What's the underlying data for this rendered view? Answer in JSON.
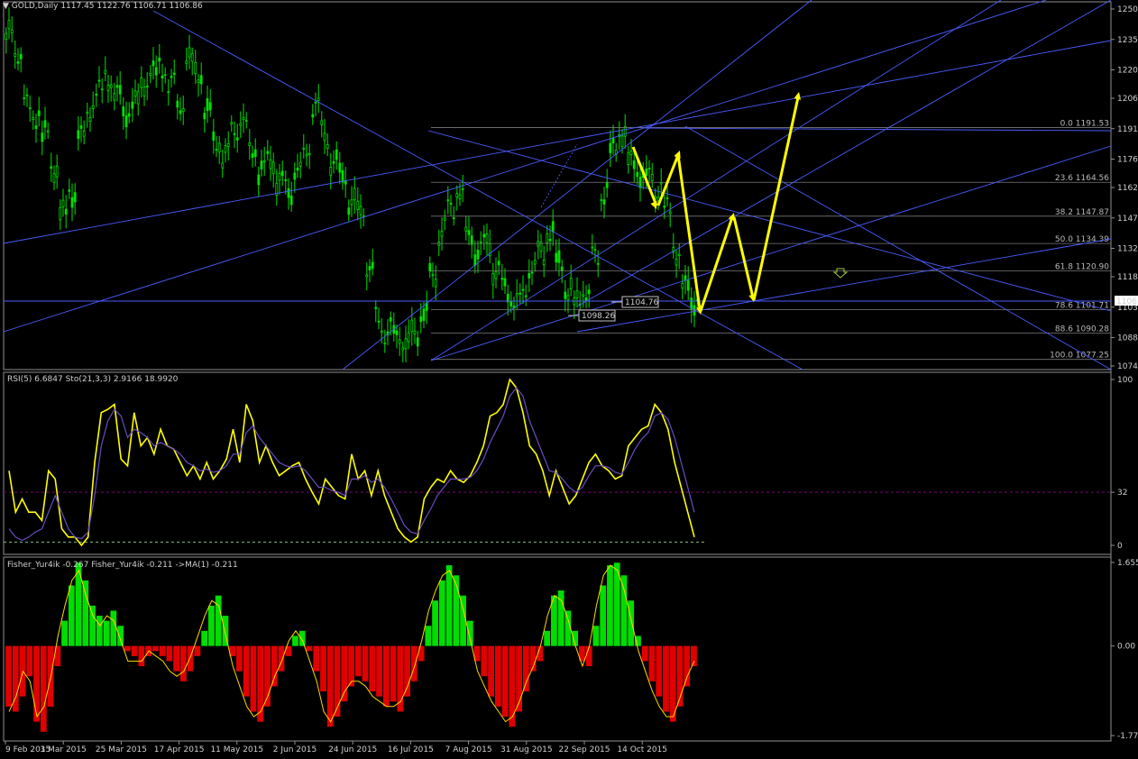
{
  "header": {
    "menu_arrow": "▼",
    "symbol": "GOLD,Daily",
    "ohlc": "1117.45 1122.76 1106.71 1106.86"
  },
  "rsi_panel": {
    "label": "RSI(5) 6.6847  Sto(21,3,3) 2.9166 18.9920"
  },
  "fisher_panel": {
    "label": "Fisher_Yur4ik -0.267  Fisher_Yur4ik -0.211  ->MA(1) -0.211"
  },
  "colors": {
    "background": "#000000",
    "candle": "#00e000",
    "trendline": "#4a5cff",
    "arrow": "#ffff00",
    "rsi": "#ffff00",
    "stoch": "#6a4cc0",
    "hist_pos": "#00dd00",
    "hist_neg": "#e00000",
    "grid_text": "#cfcfcf"
  },
  "chart_data": [
    {
      "type": "candlestick",
      "ylim": [
        1074,
        1250
      ],
      "yticks": [
        "1250",
        "1235",
        "1220",
        "1206",
        "1191",
        "1176",
        "1162",
        "1147",
        "1132",
        "1118",
        "1103",
        "1088",
        "1074"
      ],
      "current_price": "1106",
      "fibonacci": [
        {
          "label": "0.0  1191.53"
        },
        {
          "label": "23.6  1164.56"
        },
        {
          "label": "38.2  1147.87"
        },
        {
          "label": "50.0  1134.39"
        },
        {
          "label": "61.8  1120.90"
        },
        {
          "label": "78.6  1101.71"
        },
        {
          "label": "88.6  1090.28"
        },
        {
          "label": "100.0  1077.25"
        }
      ],
      "annotations": [
        "1098.26",
        "1104.76"
      ]
    },
    {
      "type": "line",
      "yticks": [
        "100",
        "32",
        "0"
      ],
      "series": [
        {
          "values": [
            45,
            20,
            28,
            20,
            20,
            15,
            45,
            40,
            10,
            5,
            5,
            0,
            5,
            50,
            80,
            82,
            85,
            52,
            48,
            80,
            60,
            65,
            55,
            70,
            60,
            58,
            50,
            42,
            48,
            40,
            50,
            40,
            45,
            52,
            70,
            50,
            85,
            75,
            50,
            60,
            50,
            42,
            45,
            48,
            50,
            40,
            32,
            25,
            40,
            35,
            30,
            28,
            55,
            40,
            45,
            30,
            45,
            30,
            20,
            10,
            5,
            2,
            5,
            28,
            35,
            40,
            38,
            45,
            40,
            38,
            42,
            50,
            60,
            78,
            80,
            85,
            100,
            95,
            80,
            60,
            55,
            45,
            30,
            45,
            35,
            25,
            30,
            40,
            50,
            55,
            48,
            45,
            40,
            42,
            60,
            65,
            70,
            72,
            85,
            80,
            70,
            50,
            35,
            20,
            5
          ]
        },
        {
          "values": [
            10,
            5,
            3,
            5,
            8,
            10,
            20,
            30,
            20,
            10,
            5,
            4,
            8,
            30,
            60,
            75,
            82,
            78,
            65,
            70,
            68,
            65,
            60,
            62,
            60,
            58,
            55,
            50,
            48,
            45,
            46,
            44,
            45,
            48,
            55,
            55,
            68,
            72,
            65,
            60,
            55,
            50,
            48,
            47,
            48,
            45,
            40,
            35,
            35,
            33,
            32,
            30,
            40,
            40,
            42,
            38,
            40,
            35,
            28,
            20,
            12,
            8,
            7,
            15,
            22,
            30,
            35,
            40,
            40,
            40,
            41,
            45,
            52,
            62,
            70,
            78,
            90,
            95,
            90,
            75,
            65,
            55,
            45,
            44,
            40,
            35,
            32,
            35,
            42,
            48,
            48,
            47,
            44,
            43,
            50,
            58,
            64,
            68,
            78,
            80,
            76,
            65,
            50,
            35,
            20
          ]
        }
      ]
    },
    {
      "type": "bar",
      "yticks": [
        "1.655",
        "0.00",
        "-1.775"
      ],
      "series": [
        {
          "values": [
            -1.2,
            -1.3,
            -1.0,
            -0.6,
            -1.5,
            -1.7,
            -1.2,
            -0.4,
            0.5,
            1.2,
            1.65,
            1.3,
            0.8,
            0.6,
            0.5,
            0.7,
            0.4,
            -0.1,
            -0.2,
            -0.4,
            -0.2,
            -0.1,
            -0.2,
            -0.3,
            -0.5,
            -0.7,
            -0.5,
            -0.2,
            0.3,
            0.8,
            1.0,
            0.6,
            -0.2,
            -0.5,
            -1.0,
            -1.3,
            -1.5,
            -1.2,
            -0.8,
            -0.5,
            -0.2,
            0.2,
            0.3,
            -0.1,
            -0.5,
            -0.9,
            -1.6,
            -1.4,
            -1.1,
            -0.8,
            -0.6,
            -0.7,
            -0.9,
            -1.0,
            -1.2,
            -1.1,
            -1.3,
            -1.0,
            -0.7,
            -0.3,
            0.4,
            0.9,
            1.3,
            1.6,
            1.4,
            1.0,
            0.5,
            -0.3,
            -0.6,
            -1.0,
            -1.2,
            -1.4,
            -1.6,
            -1.3,
            -0.9,
            -0.5,
            -0.3,
            0.3,
            1.0,
            1.1,
            0.7,
            0.3,
            -0.3,
            -0.4,
            0.4,
            1.2,
            1.6,
            1.65,
            1.4,
            0.9,
            0.2,
            -0.3,
            -0.7,
            -1.0,
            -1.3,
            -1.5,
            -1.2,
            -0.8,
            -0.4
          ]
        },
        {
          "values": [
            -1.3,
            -1.0,
            -0.5,
            -0.7,
            -1.4,
            -1.2,
            -0.6,
            0.2,
            0.8,
            1.3,
            1.5,
            1.0,
            0.6,
            0.4,
            0.6,
            0.5,
            0.1,
            -0.3,
            -0.3,
            -0.3,
            -0.1,
            -0.2,
            -0.3,
            -0.5,
            -0.6,
            -0.5,
            -0.2,
            0.2,
            0.6,
            0.9,
            0.8,
            0.2,
            -0.4,
            -0.8,
            -1.2,
            -1.4,
            -1.3,
            -1.0,
            -0.6,
            -0.3,
            0.1,
            0.3,
            0.1,
            -0.3,
            -0.7,
            -1.3,
            -1.5,
            -1.2,
            -0.9,
            -0.7,
            -0.7,
            -0.8,
            -1.0,
            -1.1,
            -1.2,
            -1.2,
            -1.1,
            -0.8,
            -0.4,
            0.1,
            0.7,
            1.1,
            1.4,
            1.5,
            1.2,
            0.7,
            0.1,
            -0.5,
            -0.8,
            -1.1,
            -1.3,
            -1.5,
            -1.4,
            -1.1,
            -0.7,
            -0.4,
            0.0,
            0.6,
            1.0,
            0.9,
            0.5,
            0.0,
            -0.4,
            0.0,
            0.8,
            1.4,
            1.6,
            1.5,
            1.1,
            0.5,
            -0.1,
            -0.5,
            -0.9,
            -1.2,
            -1.4,
            -1.4,
            -1.0,
            -0.6,
            -0.3
          ]
        }
      ]
    }
  ],
  "x_axis": {
    "ticks": [
      "9 Feb 2015",
      "3 Mar 2015",
      "25 Mar 2015",
      "17 Apr 2015",
      "11 May 2015",
      "2 Jun 2015",
      "24 Jun 2015",
      "16 Jul 2015",
      "7 Aug 2015",
      "31 Aug 2015",
      "22 Sep 2015",
      "14 Oct 2015"
    ]
  }
}
